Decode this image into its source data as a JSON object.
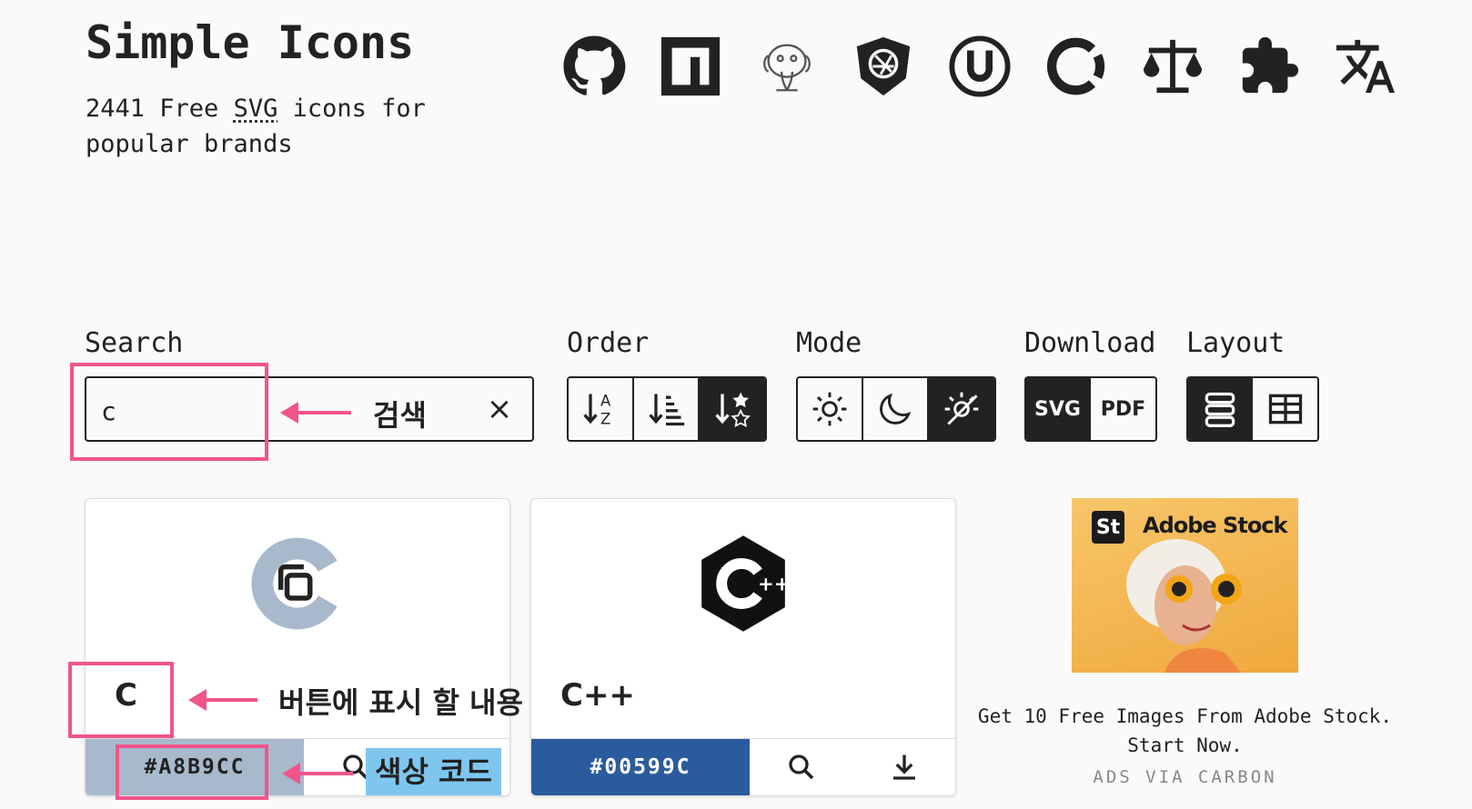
{
  "header": {
    "title": "Simple Icons",
    "subtitle_pre": "2441 Free ",
    "subtitle_abbr": "SVG",
    "subtitle_post": " icons for popular brands",
    "icons": [
      "github-icon",
      "npm-icon",
      "elephant-logo-icon",
      "shield-icon",
      "ulule-icon",
      "open-collective-icon",
      "scales-icon",
      "puzzle-icon",
      "translate-icon"
    ]
  },
  "controls": {
    "search_label": "Search",
    "search_value": "c",
    "clear_glyph": "×",
    "order_label": "Order",
    "mode_label": "Mode",
    "download_label": "Download",
    "download_svg": "SVG",
    "download_pdf": "PDF",
    "layout_label": "Layout"
  },
  "cards": [
    {
      "name": "C",
      "hex": "#A8B9CC",
      "color": "#A8B9CC",
      "hex_text_color": "#222222"
    },
    {
      "name": "C++",
      "hex": "#00599C",
      "color": "#2a5b9c",
      "hex_text_color": "#ffffff"
    }
  ],
  "ad": {
    "brand": "Adobe Stock",
    "brand_badge": "St",
    "text": "Get 10 Free Images From Adobe Stock. Start Now.",
    "via": "ADS VIA CARBON"
  },
  "annotations": {
    "search": "검색",
    "button_content": "버튼에 표시 할 내용",
    "color_code": "색상 코드",
    "color_code_bg": "#7fc6ef",
    "highlight_color": "#f0558a"
  }
}
